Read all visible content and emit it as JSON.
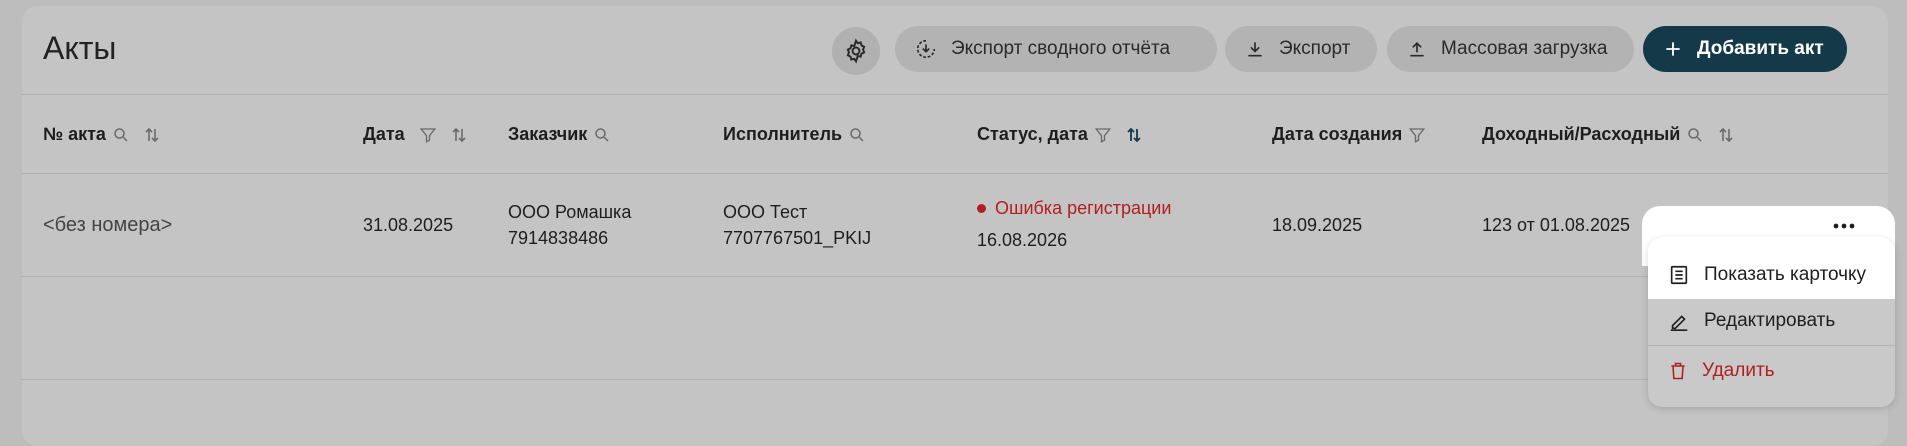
{
  "page": {
    "title": "Акты"
  },
  "toolbar": {
    "export_summary": "Экспорт сводного отчёта",
    "export": "Экспорт",
    "bulk_upload": "Массовая загрузка",
    "add_act": "Добавить акт"
  },
  "columns": {
    "number": "№ акта",
    "date": "Дата",
    "customer": "Заказчик",
    "contractor": "Исполнитель",
    "status": "Статус, дата",
    "created": "Дата создания",
    "income_expense": "Доходный/Расходный"
  },
  "rows": [
    {
      "number": "<без номера>",
      "date": "31.08.2025",
      "customer_name": "ООО Ромашка",
      "customer_inn": "7914838486",
      "contractor_name": "ООО Тест",
      "contractor_inn": "7707767501_PKIJ",
      "status": "Ошибка регистрации",
      "status_date": "16.08.2026",
      "created": "18.09.2025",
      "income_expense": "123 от 01.08.2025"
    }
  ],
  "context_menu": {
    "show_card": "Показать карточку",
    "edit": "Редактировать",
    "delete": "Удалить"
  },
  "colors": {
    "primary": "#143a4a",
    "error": "#b11f1f"
  }
}
